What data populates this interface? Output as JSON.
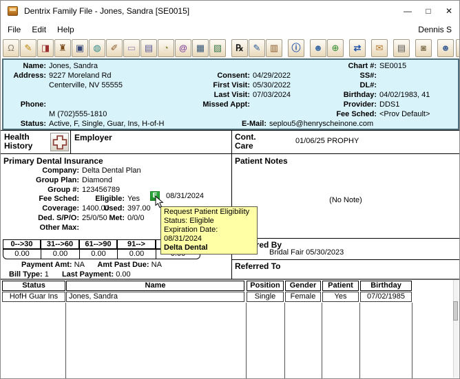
{
  "colors": {
    "panel_blue": "#d9f3fa",
    "panel_border": "#4d6e7a",
    "tooltip_bg": "#ffffa6",
    "eligible_green": "#2fae3f",
    "eligible_green_dark": "#1b7f28"
  },
  "window": {
    "title": "Dentrix Family File - Jones, Sandra [SE0015]",
    "controls": {
      "minimize": "—",
      "maximize": "□",
      "close": "✕"
    }
  },
  "menu": {
    "items": [
      "File",
      "Edit",
      "Help"
    ],
    "user": "Dennis S"
  },
  "toolbar": {
    "icons": [
      {
        "name": "patient-tooth-icon",
        "glyph": "Ω"
      },
      {
        "name": "patient-notes-icon",
        "glyph": "✎"
      },
      {
        "name": "ledger-book-icon",
        "glyph": "◨"
      },
      {
        "name": "office-manager-icon",
        "glyph": "♜"
      },
      {
        "name": "family-file-card-icon",
        "glyph": "▣"
      },
      {
        "name": "web-tooth-icon",
        "glyph": "◍"
      },
      {
        "name": "perio-probe-icon",
        "glyph": "✐"
      },
      {
        "name": "document-blank-icon",
        "glyph": "▭"
      },
      {
        "name": "document-lines-icon",
        "glyph": "▤"
      },
      {
        "name": "folder-clock-icon",
        "glyph": "◔"
      },
      {
        "name": "email-at-icon",
        "glyph": "@"
      },
      {
        "name": "questionnaire-grid-icon",
        "glyph": "▦"
      },
      {
        "name": "document-seal-icon",
        "glyph": "▧"
      },
      {
        "name": "prescription-rx-icon",
        "glyph": "℞"
      },
      {
        "name": "treatment-book-icon",
        "glyph": "✎"
      },
      {
        "name": "document-drawer-icon",
        "glyph": "▥"
      },
      {
        "name": "patient-info-icon",
        "glyph": "ⓘ"
      },
      {
        "name": "patient-picture-icon",
        "glyph": "☻"
      },
      {
        "name": "add-family-member-icon",
        "glyph": "⊕"
      },
      {
        "name": "patient-transfer-icon",
        "glyph": "⇄"
      },
      {
        "name": "message-clock-icon",
        "glyph": "✉"
      },
      {
        "name": "printer-icon",
        "glyph": "▤"
      },
      {
        "name": "patient-portrait-icon",
        "glyph": "◙"
      },
      {
        "name": "patient-form-icon",
        "glyph": "☻"
      },
      {
        "name": "clipped-edge-icon",
        "glyph": "▮"
      }
    ]
  },
  "patient": {
    "name_label": "Name:",
    "name": "Jones, Sandra",
    "address_label": "Address:",
    "address1": "9227 Moreland Rd",
    "address2": "Centerville, NV  55555",
    "phone_label": "Phone:",
    "phone_mobile": "M (702)555-1810",
    "status_label": "Status:",
    "status": "Active, F, Single, Guar, Ins, H-of-H",
    "consent_label": "Consent:",
    "consent": "04/29/2022",
    "first_visit_label": "First Visit:",
    "first_visit": "05/30/2022",
    "last_visit_label": "Last Visit:",
    "last_visit": "07/03/2024",
    "missed_appt_label": "Missed Appt:",
    "missed_appt": "",
    "email_label": "E-Mail:",
    "email": "seplou5@henryscheinone.com",
    "chart_label": "Chart #:",
    "chart": "SE0015",
    "ss_label": "SS#:",
    "ss": "",
    "dl_label": "DL#:",
    "dl": "",
    "birthday_label": "Birthday:",
    "birthday": "04/02/1983, 41",
    "provider_label": "Provider:",
    "provider": "DDS1",
    "fee_sched_label": "Fee Sched:",
    "fee_sched": "<Prov Default>"
  },
  "sections": {
    "health_history_line1": "Health",
    "health_history_line2": "History",
    "employer": "Employer",
    "cont_care_line1": "Cont.",
    "cont_care_line2": "Care",
    "cont_care_value": "01/06/25 PROPHY"
  },
  "insurance": {
    "title": "Primary Dental Insurance",
    "company_label": "Company:",
    "company": "Delta Dental Plan",
    "group_plan_label": "Group Plan:",
    "group_plan": "Diamond",
    "group_num_label": "Group #:",
    "group_num": "123456789",
    "fee_sched_label": "Fee Sched:",
    "fee_sched": "",
    "eligible_label": "Eligible:",
    "eligible": "Yes",
    "eligible_icon": "E",
    "eligible_date": "08/31/2024",
    "coverage_label": "Coverage:",
    "coverage": "1400.00",
    "used_label": "Used:",
    "used": "397.00",
    "ded_label": "Ded. S/P/O:",
    "ded": "25/0/50",
    "met_label": "Met:",
    "met": "0/0/0",
    "other_max_label": "Other Max:",
    "other_max": ""
  },
  "aging": {
    "headers": [
      "0-->30",
      "31-->60",
      "61-->90",
      "91-->",
      ""
    ],
    "values": [
      "0.00",
      "0.00",
      "0.00",
      "0.00",
      "0.00"
    ],
    "payment_amt_label": "Payment Amt:",
    "payment_amt": "NA",
    "amt_past_due_label": "Amt Past Due:",
    "amt_past_due": "NA",
    "bill_type_label": "Bill Type:",
    "bill_type": "1",
    "last_payment_label": "Last Payment:",
    "last_payment": "0.00"
  },
  "notes": {
    "title": "Patient Notes",
    "empty": "(No Note)"
  },
  "referred_by": {
    "title": "Referred By",
    "value": "Bridal Fair 05/30/2023"
  },
  "referred_to": {
    "title": "Referred To"
  },
  "tooltip": {
    "line1": "Request Patient Eligibility",
    "line2": "Status: Eligible",
    "line3": "Expiration Date: 08/31/2024",
    "line4": "Delta Dental"
  },
  "family_table": {
    "headers": [
      "Status",
      "Name",
      "Position",
      "Gender",
      "Patient",
      "Birthday"
    ],
    "rows": [
      [
        "HofH Guar Ins",
        "Jones, Sandra",
        "Single",
        "Female",
        "Yes",
        "07/02/1985"
      ]
    ]
  }
}
